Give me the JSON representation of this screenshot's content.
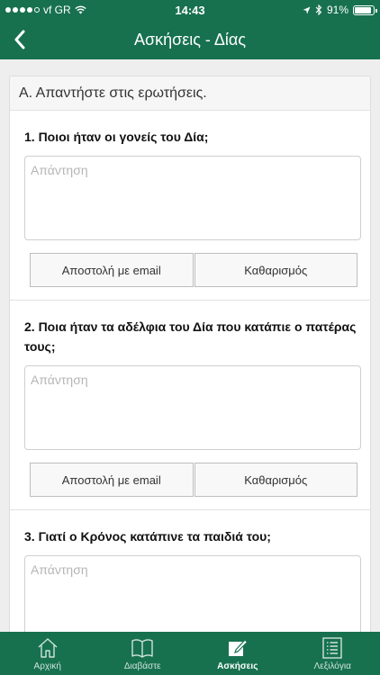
{
  "status_bar": {
    "carrier": "vf GR",
    "time": "14:43",
    "battery": "91%",
    "battery_level": 0.91
  },
  "nav": {
    "title": "Ασκήσεις - Δίας"
  },
  "card": {
    "header": "Α. Απαντήστε στις ερωτήσεις."
  },
  "questions": [
    {
      "text": "1. Ποιοι ήταν οι γονείς του Δία;",
      "placeholder": "Απάντηση",
      "email_label": "Αποστολή με email",
      "clear_label": "Καθαρισμός"
    },
    {
      "text": "2. Ποια ήταν τα αδέλφια του Δία που κατάπιε ο πατέρας τους;",
      "placeholder": "Απάντηση",
      "email_label": "Αποστολή με email",
      "clear_label": "Καθαρισμός"
    },
    {
      "text": "3. Γιατί ο Κρόνος κατάπινε τα παιδιά του;",
      "placeholder": "Απάντηση"
    }
  ],
  "tabs": [
    {
      "label": "Αρχική",
      "icon": "home-icon",
      "active": false
    },
    {
      "label": "Διαβάστε",
      "icon": "book-icon",
      "active": false
    },
    {
      "label": "Ασκήσεις",
      "icon": "edit-icon",
      "active": true
    },
    {
      "label": "Λεξιλόγια",
      "icon": "list-icon",
      "active": false
    }
  ],
  "colors": {
    "primary": "#17714f"
  }
}
